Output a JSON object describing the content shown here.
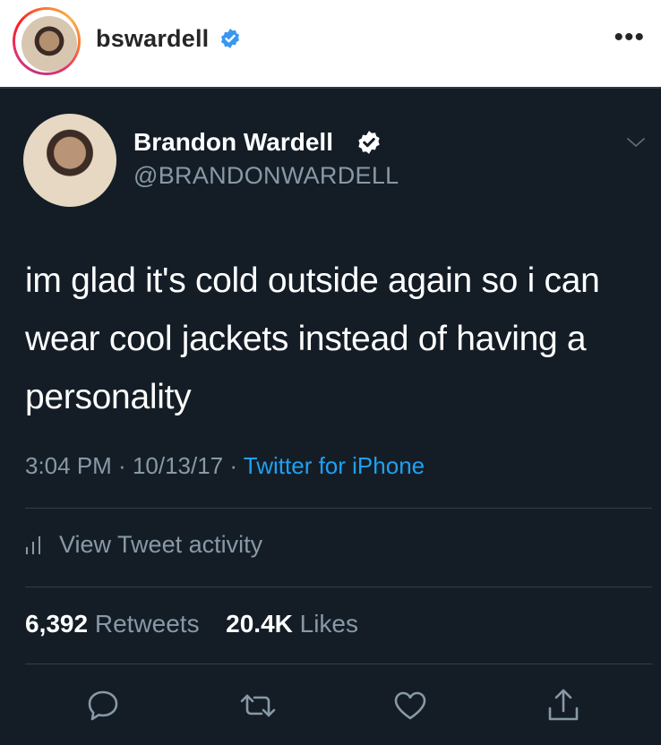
{
  "instagram": {
    "username": "bswardell",
    "more_glyph": "•••",
    "icons": [
      "verified-badge-icon",
      "more-options-icon"
    ]
  },
  "tweet": {
    "display_name": "Brandon Wardell",
    "handle": "@BRANDONWARDELL",
    "text": "im glad it's cold outside again so i can wear cool jackets instead of having a personality",
    "time": "3:04 PM",
    "date": "10/13/17",
    "source": "Twitter for iPhone",
    "meta_separator": " · ",
    "activity_label": "View Tweet activity",
    "retweets_count": "6,392",
    "retweets_label": "Retweets",
    "likes_count": "20.4K",
    "likes_label": "Likes",
    "actions": [
      "reply-icon",
      "retweet-icon",
      "like-icon",
      "share-icon"
    ]
  },
  "colors": {
    "tweet_background": "#141d26",
    "secondary_text": "#8899a6",
    "link_blue": "#1da1f2",
    "verified_blue": "#3897f0"
  }
}
